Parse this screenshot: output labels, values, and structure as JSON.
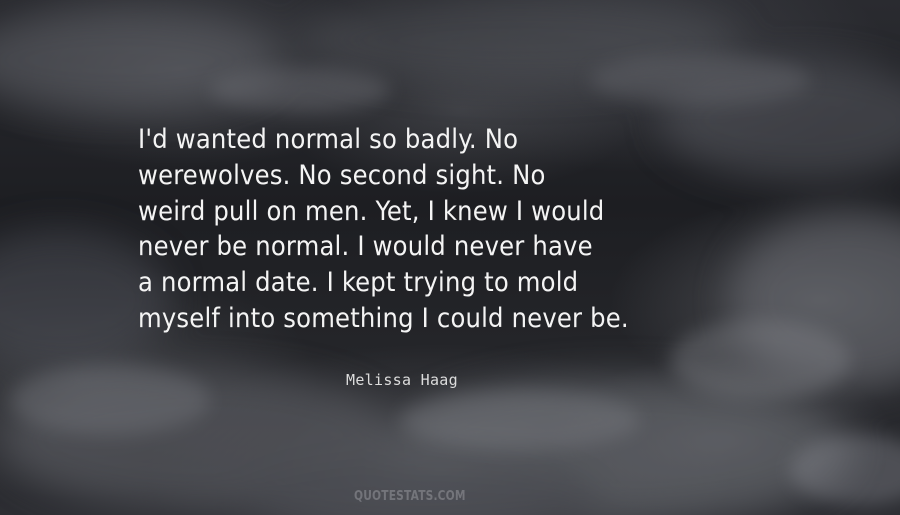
{
  "quote": {
    "lines": [
      "I'd wanted normal so badly.  No",
      "werewolves.  No second sight.  No",
      "weird pull on men.  Yet, I knew I would",
      "never be normal.  I would never have",
      "a normal date.  I kept trying to mold",
      "myself into something I could never be."
    ]
  },
  "author": "Melissa Haag",
  "watermark": "QUOTESTATS.COM"
}
